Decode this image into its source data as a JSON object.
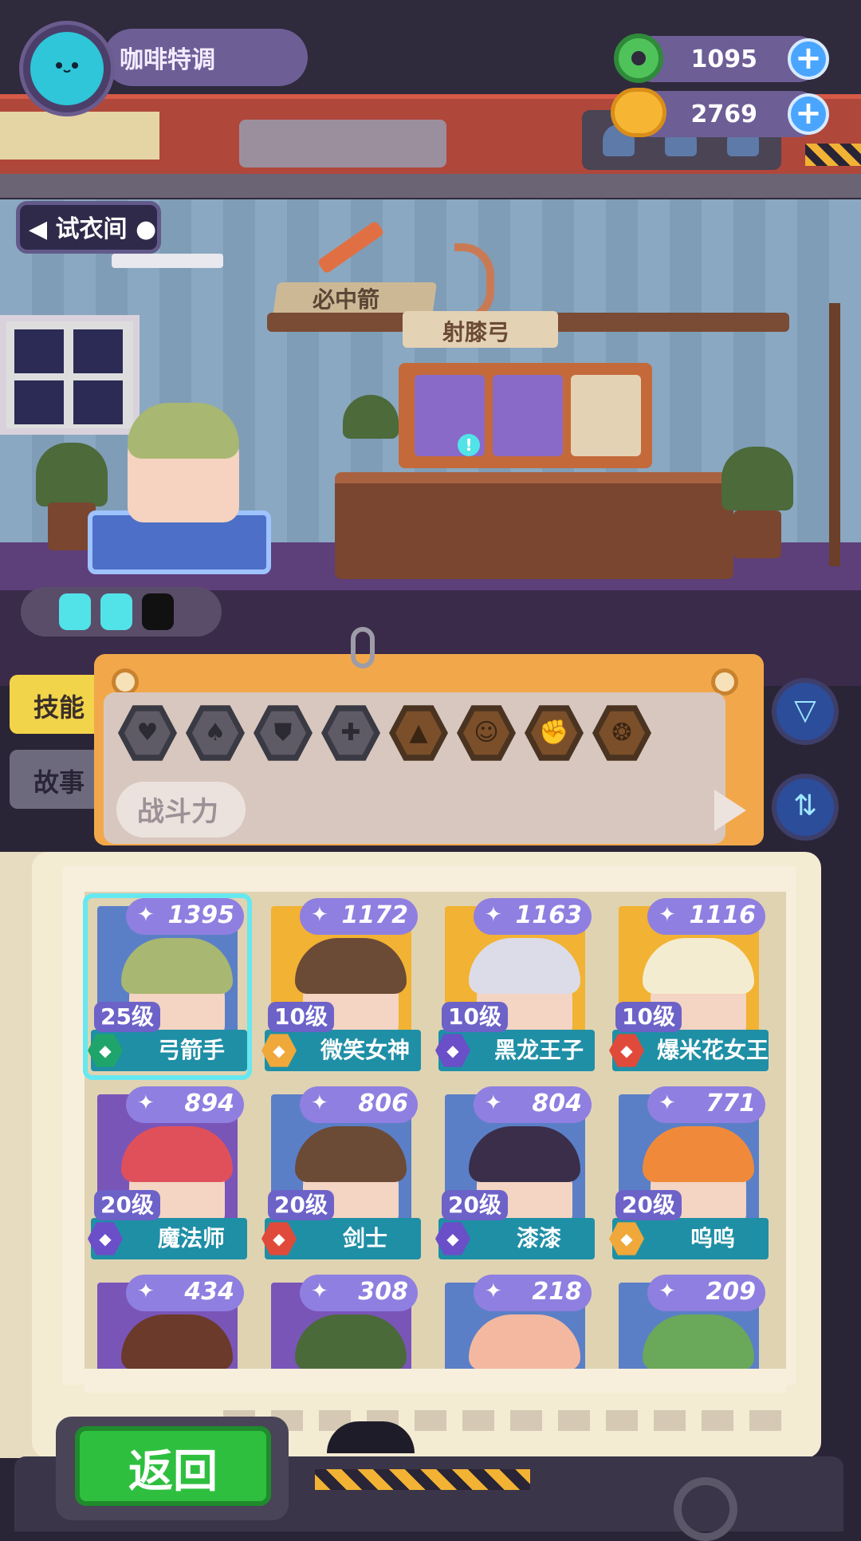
{
  "header": {
    "player_name": "咖啡特调",
    "currency_gems": "1095",
    "currency_coins": "2769",
    "plus_label": "+"
  },
  "room": {
    "back_label": "试衣间",
    "sign_top": "必中箭",
    "sign_bottom": "射膝弓"
  },
  "tabs": {
    "skills": "技能",
    "story": "故事"
  },
  "filter_panel": {
    "hexes": [
      {
        "icon": "heart-icon",
        "glyph": "♥"
      },
      {
        "icon": "sword-icon",
        "glyph": "♠"
      },
      {
        "icon": "shield-icon",
        "glyph": "⛊"
      },
      {
        "icon": "staff-icon",
        "glyph": "✚"
      },
      {
        "icon": "boot-icon",
        "glyph": "▲"
      },
      {
        "icon": "smile-icon",
        "glyph": "☺"
      },
      {
        "icon": "muscle-icon",
        "glyph": "✊"
      },
      {
        "icon": "brain-icon",
        "glyph": "❂"
      }
    ],
    "sort_label": "战斗力",
    "filter_icon": "filter-icon",
    "sort_icon": "sort-icon"
  },
  "characters": [
    {
      "power": "1395",
      "level": "25级",
      "name": "弓箭手",
      "hair": "#a8b771",
      "bg": "#5b7fc7",
      "badge": "#1fa56b"
    },
    {
      "power": "1172",
      "level": "10级",
      "name": "微笑女神",
      "hair": "#6b4a36",
      "bg": "#f2b233",
      "badge": "#f0a83a"
    },
    {
      "power": "1163",
      "level": "10级",
      "name": "黑龙王子",
      "hair": "#dcdce8",
      "bg": "#f2b233",
      "badge": "#6a4fc8"
    },
    {
      "power": "1116",
      "level": "10级",
      "name": "爆米花女王",
      "hair": "#f4ecd0",
      "bg": "#f2b233",
      "badge": "#e04a3a"
    },
    {
      "power": "894",
      "level": "20级",
      "name": "魔法师",
      "hair": "#e0505a",
      "bg": "#7a55b8",
      "badge": "#6a4fc8"
    },
    {
      "power": "806",
      "level": "20级",
      "name": "剑士",
      "hair": "#6b4a36",
      "bg": "#5b7fc7",
      "badge": "#e04a3a"
    },
    {
      "power": "804",
      "level": "20级",
      "name": "漆漆",
      "hair": "#3b2e4a",
      "bg": "#5b7fc7",
      "badge": "#6a4fc8"
    },
    {
      "power": "771",
      "level": "20级",
      "name": "呜呜",
      "hair": "#f08a3a",
      "bg": "#5b7fc7",
      "badge": "#f0a83a"
    },
    {
      "power": "434",
      "hair": "#6b3a2a",
      "bg": "#7a55b8"
    },
    {
      "power": "308",
      "hair": "#4a6a3a",
      "bg": "#7a55b8"
    },
    {
      "power": "218",
      "hair": "#f4b8a0",
      "bg": "#5b7fc7"
    },
    {
      "power": "209",
      "hair": "#6aa85a",
      "bg": "#5b7fc7"
    }
  ],
  "footer": {
    "back_label": "返回"
  }
}
